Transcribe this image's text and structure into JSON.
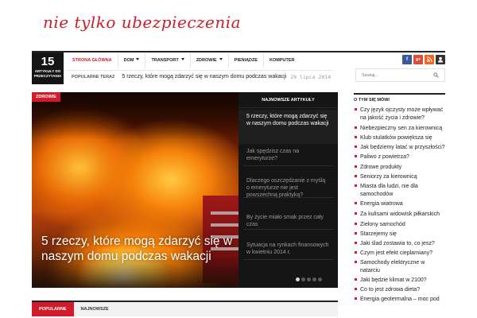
{
  "site": {
    "logo_text": "nie tylko ubezpieczenia",
    "accent_color": "#d01c2a"
  },
  "counter": {
    "number": "15",
    "label": "ARTYKUŁY DO PRZECZYTANIA"
  },
  "nav": {
    "items": [
      {
        "label": "STRONA GŁÓWNA",
        "active": true,
        "dropdown": false
      },
      {
        "label": "DOM",
        "active": false,
        "dropdown": true
      },
      {
        "label": "TRANSPORT",
        "active": false,
        "dropdown": true
      },
      {
        "label": "ZDROWIE",
        "active": false,
        "dropdown": true
      },
      {
        "label": "PIENIĄDZE",
        "active": false,
        "dropdown": false
      },
      {
        "label": "KOMPUTER",
        "active": false,
        "dropdown": false
      }
    ]
  },
  "social": {
    "facebook": {
      "label": "f",
      "color": "#3b5998"
    },
    "googleplus": {
      "label": "g+",
      "color": "#dd4b39"
    },
    "rss": {
      "label": "rss",
      "color": "#f26522"
    },
    "user": {
      "label": "user",
      "color": "#333333"
    }
  },
  "ticker": {
    "label": "POPULARNE TERAZ",
    "title": "5 rzeczy, które mogą zdarzyć się w naszym domu podczas wakacji",
    "date": "29 lipca 2014"
  },
  "search": {
    "placeholder": "Szukaj..."
  },
  "hero": {
    "badge": "ZDROWIE",
    "title": "5 rzeczy, które mogą zdarzyć się w naszym domu podczas wakacji"
  },
  "newest": {
    "header": "NAJNOWSZE ARTYKUŁY",
    "items": [
      {
        "title": "5 rzeczy, które mogą zdarzyć się w naszym domu podczas wakacji",
        "active": true
      },
      {
        "title": "Jak spędzisz czas na emeryturze?",
        "active": false
      },
      {
        "title": "Dlaczego oszczędzanie z myślą o emeryturze nie jest powszechną praktyką?",
        "active": false
      },
      {
        "title": "By życie miało smak przez cały czas",
        "active": false
      },
      {
        "title": "Sytuacja na rynkach finansowych w kwietniu 2014 r.",
        "active": false
      }
    ],
    "pagination_active": 1
  },
  "about": {
    "header": "O TYM SIĘ MÓWI",
    "items": [
      "Czy język ojczysty może wpływać na jakość życia i zdrowie?",
      "Niebezpieczny sen za kierownicą",
      "Klub stulatków powiększa się",
      "Jak będziemy latać w przyszłości?",
      "Paliwo z powietrza?",
      "Zdrowe produkty",
      "Seniorzy za kierownicą",
      "Miasta dla ludzi, nie dla samochodów",
      "Energia wiatrowa",
      "Za kulisami widowisk piłkarskich",
      "Zielony samochód",
      "Starzejemy się",
      "Jaki ślad zostawia to, co jesz?",
      "Czym jest efekt cieplarniany?",
      "Samochody elektryczne w natarciu",
      "Jaki będzie klimat w 2100?",
      "Co to jest zdrowa dieta?",
      "Energia geotermalna – moc pod"
    ]
  },
  "tabs": {
    "popular": "POPULARNE",
    "newest": "NAJNOWSZE"
  }
}
